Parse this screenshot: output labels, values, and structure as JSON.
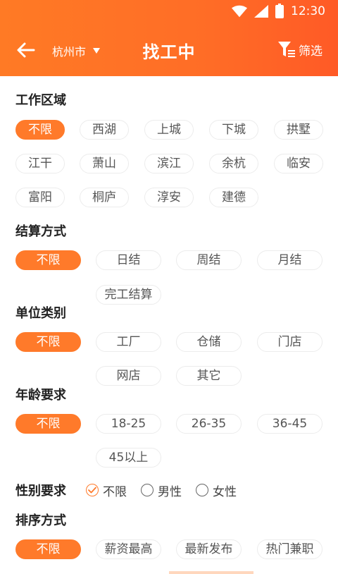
{
  "status": {
    "time": "12:30"
  },
  "header": {
    "city": "杭州市",
    "title": "找工中",
    "filter_label": "筛选"
  },
  "sections": {
    "area": {
      "title": "工作区域",
      "options": [
        "不限",
        "西湖",
        "上城",
        "下城",
        "拱墅",
        "江干",
        "萧山",
        "滨江",
        "余杭",
        "临安",
        "富阳",
        "桐庐",
        "淳安",
        "建德"
      ],
      "selected": "不限"
    },
    "settlement": {
      "title": "结算方式",
      "options": [
        "不限",
        "日结",
        "周结",
        "月结",
        "完工结算"
      ],
      "selected": "不限"
    },
    "unit": {
      "title": "单位类别",
      "options": [
        "不限",
        "工厂",
        "仓储",
        "门店",
        "网店",
        "其它"
      ],
      "selected": "不限"
    },
    "age": {
      "title": "年龄要求",
      "options": [
        "不限",
        "18-25",
        "26-35",
        "36-45",
        "45以上"
      ],
      "selected": "不限"
    },
    "gender": {
      "title": "性别要求",
      "options": [
        "不限",
        "男性",
        "女性"
      ],
      "selected": "不限"
    },
    "sort": {
      "title": "排序方式",
      "options": [
        "不限",
        "薪资最高",
        "最新发布",
        "热门兼职"
      ],
      "selected": "不限"
    }
  },
  "colors": {
    "accent": "#ff7a2a",
    "header_start": "#ff7a25",
    "header_end": "#ff5a26"
  }
}
